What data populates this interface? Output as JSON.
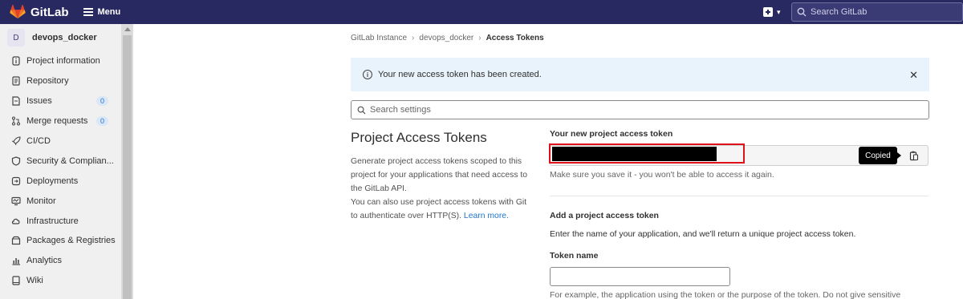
{
  "app": {
    "brand": "GitLab",
    "menu_label": "Menu",
    "search_placeholder": "Search GitLab",
    "brand_color": "#292961",
    "logo_color": "#e24329"
  },
  "sidebar": {
    "project_initial": "D",
    "project_name": "devops_docker",
    "items": [
      {
        "label": "Project information",
        "icon": "info-icon"
      },
      {
        "label": "Repository",
        "icon": "doc-icon"
      },
      {
        "label": "Issues",
        "icon": "issues-icon",
        "count": "0"
      },
      {
        "label": "Merge requests",
        "icon": "merge-request-icon",
        "count": "0"
      },
      {
        "label": "CI/CD",
        "icon": "rocket-icon"
      },
      {
        "label": "Security & Complian...",
        "icon": "shield-icon"
      },
      {
        "label": "Deployments",
        "icon": "deployments-icon"
      },
      {
        "label": "Monitor",
        "icon": "monitor-icon"
      },
      {
        "label": "Infrastructure",
        "icon": "cloud-icon"
      },
      {
        "label": "Packages & Registries",
        "icon": "package-icon"
      },
      {
        "label": "Analytics",
        "icon": "chart-icon"
      },
      {
        "label": "Wiki",
        "icon": "book-icon"
      }
    ]
  },
  "breadcrumb": {
    "items": [
      "GitLab Instance",
      "devops_docker",
      "Access Tokens"
    ],
    "separator": "›"
  },
  "alert": {
    "info_symbol": "i",
    "text": "Your new access token has been created.",
    "close_symbol": "✕",
    "bg_color": "#e9f3fc"
  },
  "settings_search": {
    "placeholder": "Search settings"
  },
  "section": {
    "title": "Project Access Tokens",
    "desc_1": "Generate project access tokens scoped to this project for your applications that need access to the GitLab API.",
    "desc_2": "You can also use project access tokens with Git to authenticate over HTTP(S).",
    "learn_more": "Learn more."
  },
  "new_token": {
    "label": "Your new project access token",
    "value": "",
    "tooltip": "Copied",
    "help": "Make sure you save it - you won't be able to access it again.",
    "highlight_color": "#e0101a"
  },
  "add_token": {
    "title": "Add a project access token",
    "desc": "Enter the name of your application, and we'll return a unique project access token.",
    "name_label": "Token name",
    "name_value": "",
    "name_help": "For example, the application using the token or the purpose of the token. Do not give sensitive"
  }
}
